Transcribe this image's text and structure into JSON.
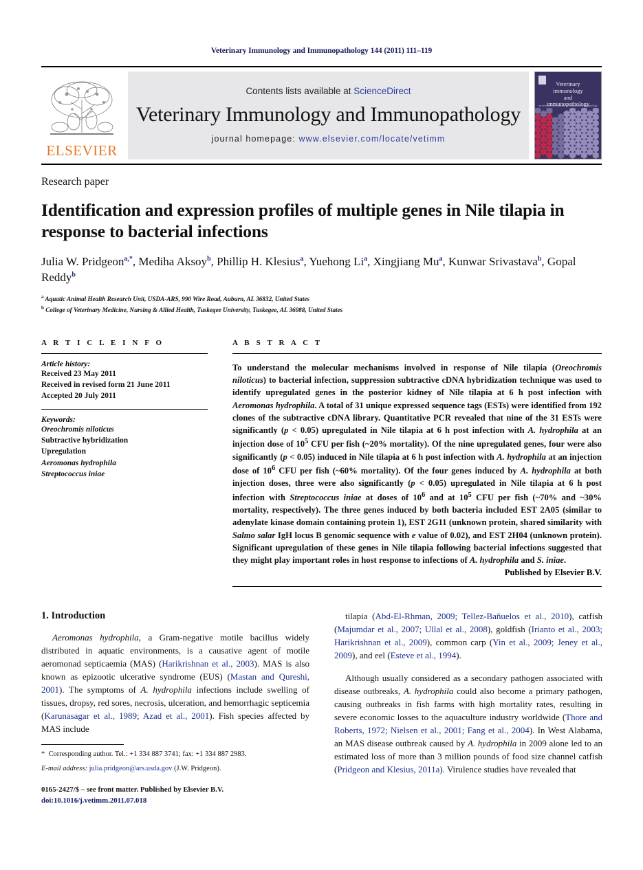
{
  "running_head": "Veterinary Immunology and Immunopathology 144 (2011) 111–119",
  "masthead": {
    "contents_prefix": "Contents lists available at ",
    "sciencedirect": "ScienceDirect",
    "journal_title": "Veterinary Immunology and Immunopathology",
    "homepage_label": "journal homepage: ",
    "homepage_url": "www.elsevier.com/locate/vetimm",
    "publisher_logo_text": "ELSEVIER",
    "cover": {
      "line1": "Veterinary",
      "line2": "immunology",
      "line3": "and",
      "line4": "immunopathology",
      "subtitle": "an international journal of comparative immunology"
    },
    "colors": {
      "link": "#2b3f9e",
      "elsevier_orange": "#E87722",
      "banner_bg": "#e7e7e9",
      "cover_bg": "#3a3260",
      "cover_red": "#c0294a",
      "cover_lavender": "#a69ccd"
    }
  },
  "article": {
    "kind": "Research paper",
    "title": "Identification and expression profiles of multiple genes in Nile tilapia in response to bacterial infections",
    "authors_html": "Julia W. Pridgeon<sup>a,*</sup>, Mediha Aksoy<sup>b</sup>, Phillip H. Klesius<sup>a</sup>, Yuehong Li<sup>a</sup>, Xingjiang Mu<sup>a</sup>, Kunwar Srivastava<sup>b</sup>, Gopal Reddy<sup>b</sup>",
    "affiliations": [
      "Aquatic Animal Health Research Unit, USDA-ARS, 990 Wire Road, Auburn, AL 36832, United States",
      "College of Veterinary Medicine, Nursing & Allied Health, Tuskegee University, Tuskegee, AL 36088, United States"
    ]
  },
  "article_info": {
    "heading": "A R T I C L E    I N F O",
    "history_label": "Article history:",
    "history": [
      "Received 23 May 2011",
      "Received in revised form 21 June 2011",
      "Accepted 20 July 2011"
    ],
    "keywords_label": "Keywords:",
    "keywords": [
      "Oreochromis niloticus",
      "Subtractive hybridization",
      "Upregulation",
      "Aeromonas hydrophila",
      "Streptococcus iniae"
    ],
    "keywords_italic": [
      true,
      false,
      false,
      true,
      true
    ]
  },
  "abstract": {
    "heading": "A B S T R A C T",
    "text_html": "To understand the molecular mechanisms involved in response of Nile tilapia (<i>Oreochromis niloticus</i>) to bacterial infection, suppression subtractive cDNA hybridization technique was used to identify upregulated genes in the posterior kidney of Nile tilapia at 6 h post infection with <i>Aeromonas hydrophila</i>. A total of 31 unique expressed sequence tags (ESTs) were identified from 192 clones of the subtractive cDNA library. Quantitative PCR revealed that nine of the 31 ESTs were significantly (<i>p</i> &lt; 0.05) upregulated in Nile tilapia at 6 h post infection with <i>A. hydrophila</i> at an injection dose of 10<sup>5</sup> CFU per fish (~20% mortality). Of the nine upregulated genes, four were also significantly (<i>p</i> &lt; 0.05) induced in Nile tilapia at 6 h post infection with <i>A. hydrophila</i> at an injection dose of 10<sup>6</sup> CFU per fish (~60% mortality). Of the four genes induced by <i>A. hydrophila</i> at both injection doses, three were also significantly (<i>p</i> &lt; 0.05) upregulated in Nile tilapia at 6 h post infection with <i>Streptococcus iniae</i> at doses of 10<sup>6</sup> and at 10<sup>5</sup> CFU per fish (~70% and ~30% mortality, respectively). The three genes induced by both bacteria included EST 2A05 (similar to adenylate kinase domain containing protein 1), EST 2G11 (unknown protein, shared similarity with <i>Salmo salar</i> IgH locus B genomic sequence with <i>e</i> value of 0.02), and EST 2H04 (unknown protein). Significant upregulation of these genes in Nile tilapia following bacterial infections suggested that they might play important roles in host response to infections of <i>A. hydrophila</i> and <i>S. iniae</i>.",
    "publisher_line": "Published by Elsevier B.V."
  },
  "introduction": {
    "heading": "1.  Introduction",
    "left_paragraphs_html": [
      "<i>Aeromonas hydrophila</i>, a Gram-negative motile bacillus widely distributed in aquatic environments, is a causative agent of motile aeromonad septicaemia (MAS) (<span class=\"ref\">Harikrishnan et al., 2003</span>). MAS is also known as epizootic ulcerative syndrome (EUS) (<span class=\"ref\">Mastan and Qureshi, 2001</span>). The symptoms of <i>A. hydrophila</i> infections include swelling of tissues, dropsy, red sores, necrosis, ulceration, and hemorrhagic septicemia (<span class=\"ref\">Karunasagar et al., 1989; Azad et al., 2001</span>). Fish species affected by MAS include"
    ],
    "right_paragraphs_html": [
      "tilapia (<span class=\"ref\">Abd-El-Rhman, 2009; Tellez-Ba&ntilde;uelos et al., 2010</span>), catfish (<span class=\"ref\">Majumdar et al., 2007; Ullal et al., 2008</span>), goldfish (<span class=\"ref\">Irianto et al., 2003; Harikrishnan et al., 2009</span>), common carp (<span class=\"ref\">Yin et al., 2009; Jeney et al., 2009</span>), and eel (<span class=\"ref\">Esteve et al., 1994</span>).",
      "Although usually considered as a secondary pathogen associated with disease outbreaks, <i>A. hydrophila</i> could also become a primary pathogen, causing outbreaks in fish farms with high mortality rates, resulting in severe economic losses to the aquaculture industry worldwide (<span class=\"ref\">Thore and Roberts, 1972; Nielsen et al., 2001; Fang et al., 2004</span>). In West Alabama, an MAS disease outbreak caused by <i>A. hydrophila</i> in 2009 alone led to an estimated loss of more than 3 million pounds of food size channel catfish (<span class=\"ref\">Pridgeon and Klesius, 2011a</span>). Virulence studies have revealed that"
    ]
  },
  "footnote": {
    "corresponding_html": "*&nbsp;&nbsp;Corresponding author. Tel.: +1 334 887 3741; fax: +1 334 887 2983.",
    "email_html": "<i>E-mail address:</i> <span class=\"fn-mail\">julia.pridgeon@ars.usda.gov</span> (J.W. Pridgeon).",
    "front_matter": "0165-2427/$ – see front matter. Published by Elsevier B.V.",
    "doi": "doi:10.1016/j.vetimm.2011.07.018"
  }
}
